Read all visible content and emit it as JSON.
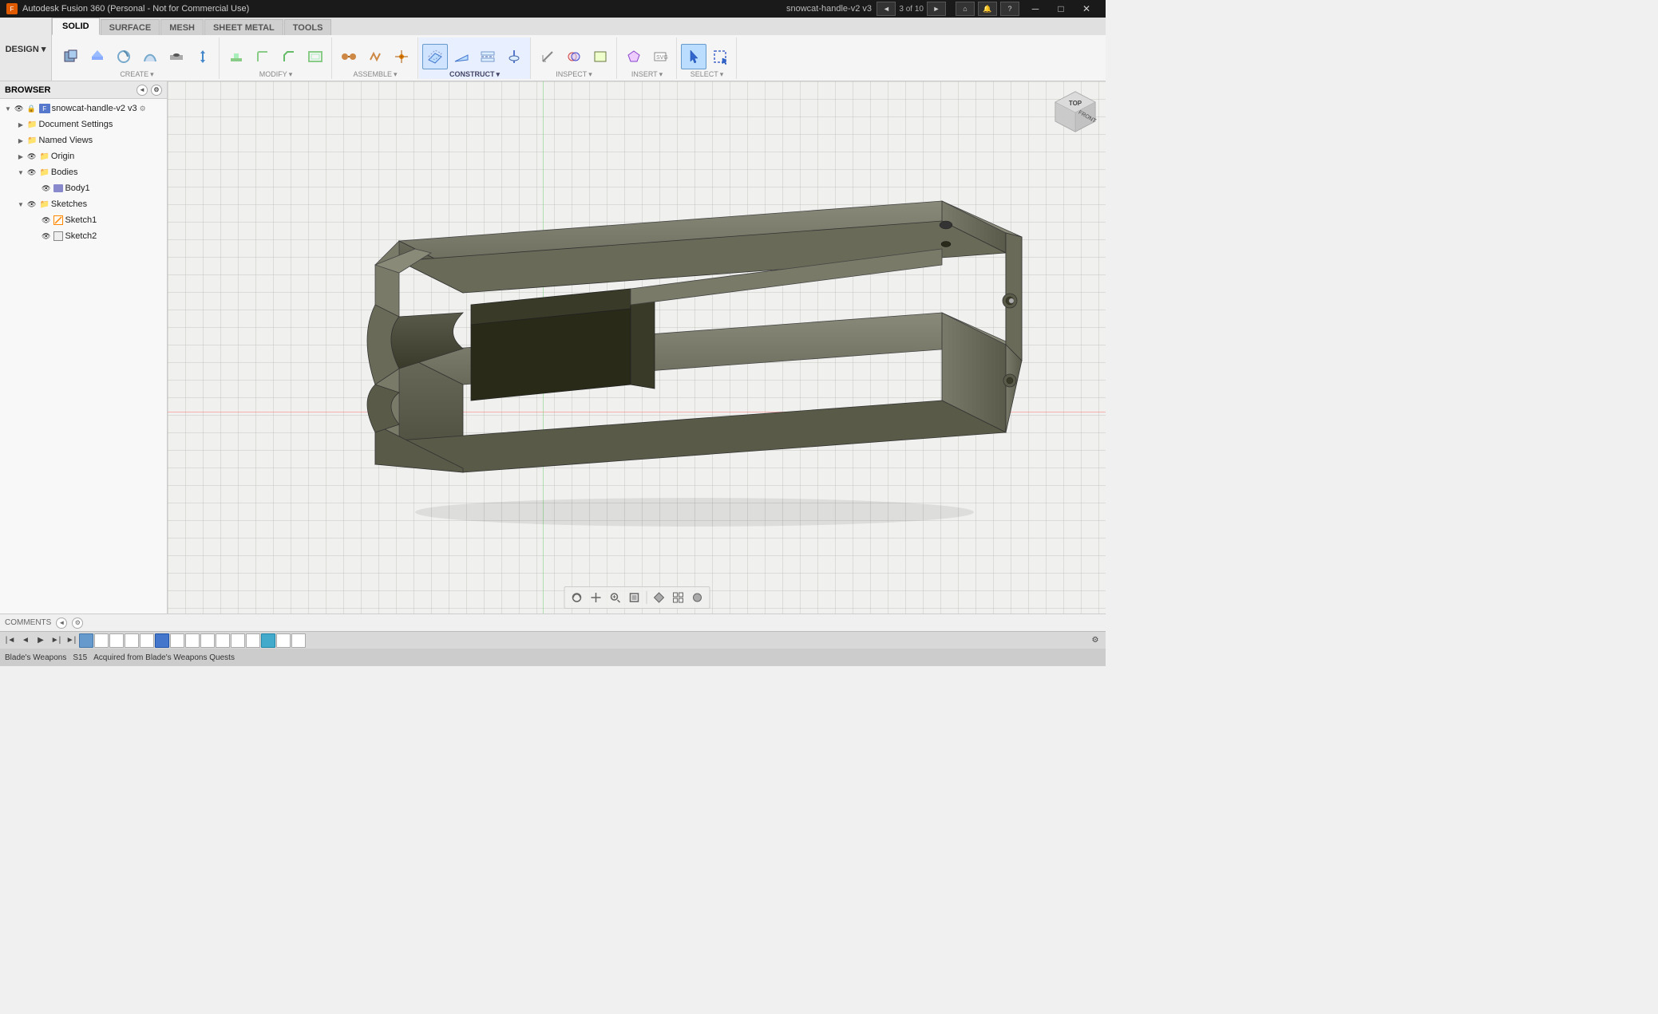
{
  "app": {
    "title": "Autodesk Fusion 360 (Personal - Not for Commercial Use)",
    "document": "snowcat-handle-v2 v3",
    "nav_count": "3 of 10"
  },
  "tabs": [
    {
      "label": "SOLID",
      "active": true
    },
    {
      "label": "SURFACE",
      "active": false
    },
    {
      "label": "MESH",
      "active": false
    },
    {
      "label": "SHEET METAL",
      "active": false
    },
    {
      "label": "TOOLS",
      "active": false
    }
  ],
  "toolbar_groups": [
    {
      "label": "CREATE",
      "has_arrow": true,
      "buttons": [
        "new-body",
        "extrude",
        "revolve",
        "sweep",
        "loft",
        "rib",
        "web",
        "hole"
      ]
    },
    {
      "label": "MODIFY",
      "has_arrow": true,
      "buttons": [
        "press-pull",
        "fillet",
        "chamfer",
        "shell",
        "draft"
      ]
    },
    {
      "label": "ASSEMBLE",
      "has_arrow": true,
      "buttons": [
        "joint",
        "motion-link",
        "joint-origin",
        "rigid-group"
      ]
    },
    {
      "label": "CONSTRUCT",
      "has_arrow": true,
      "active": true,
      "buttons": [
        "offset-plane",
        "angle-plane",
        "midplane",
        "axis-perp",
        "axis-along"
      ]
    },
    {
      "label": "INSPECT",
      "has_arrow": true,
      "buttons": [
        "measure",
        "interference",
        "curvature-comb",
        "zebra",
        "draft-analysis"
      ]
    },
    {
      "label": "INSERT",
      "has_arrow": true,
      "buttons": [
        "insert-mesh",
        "insert-svg",
        "insert-image",
        "attached-canvas"
      ]
    },
    {
      "label": "SELECT",
      "has_arrow": true,
      "active_btn": true,
      "buttons": [
        "select",
        "window-select",
        "paint-select"
      ]
    }
  ],
  "design_btn": "DESIGN ▾",
  "browser": {
    "title": "BROWSER",
    "items": [
      {
        "level": 0,
        "label": "snowcat-handle-v2 v3",
        "expanded": true,
        "type": "document",
        "visible": true,
        "eye": true
      },
      {
        "level": 1,
        "label": "Document Settings",
        "expanded": false,
        "type": "folder",
        "visible": false,
        "eye": false
      },
      {
        "level": 1,
        "label": "Named Views",
        "expanded": false,
        "type": "folder",
        "visible": false,
        "eye": false
      },
      {
        "level": 1,
        "label": "Origin",
        "expanded": false,
        "type": "folder",
        "visible": true,
        "eye": true
      },
      {
        "level": 1,
        "label": "Bodies",
        "expanded": true,
        "type": "folder",
        "visible": true,
        "eye": true
      },
      {
        "level": 2,
        "label": "Body1",
        "expanded": false,
        "type": "body",
        "visible": true,
        "eye": true
      },
      {
        "level": 1,
        "label": "Sketches",
        "expanded": true,
        "type": "folder",
        "visible": true,
        "eye": true
      },
      {
        "level": 2,
        "label": "Sketch1",
        "expanded": false,
        "type": "sketch",
        "visible": true,
        "eye": true
      },
      {
        "level": 2,
        "label": "Sketch2",
        "expanded": false,
        "type": "sketch",
        "visible": true,
        "eye": true
      }
    ]
  },
  "status_bar": {
    "comments": "COMMENTS",
    "timeline_items": 15
  },
  "viewport_tools": [
    "orbit",
    "pan",
    "zoom-window",
    "zoom-fit",
    "display-settings",
    "grid",
    "visual-style"
  ],
  "bottom_bar": {
    "text1": "Blade's Weapons",
    "text2": "S15",
    "text3": "Acquired from Blade's Weapons Quests"
  }
}
